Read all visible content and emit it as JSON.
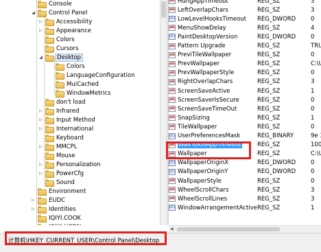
{
  "tree": {
    "items": [
      {
        "label": "Console",
        "expander": "",
        "level": 1
      },
      {
        "label": "Control Panel",
        "expander": "◢",
        "level": 1
      },
      {
        "label": "Accessibility",
        "expander": "▷",
        "level": 2
      },
      {
        "label": "Appearance",
        "expander": "▷",
        "level": 2
      },
      {
        "label": "Colors",
        "expander": "",
        "level": 2
      },
      {
        "label": "Cursors",
        "expander": "",
        "level": 2
      },
      {
        "label": "Desktop",
        "expander": "◢",
        "level": 2,
        "selected": true
      },
      {
        "label": "Colors",
        "expander": "",
        "level": 3
      },
      {
        "label": "LanguageConfiguration",
        "expander": "",
        "level": 3
      },
      {
        "label": "MuiCached",
        "expander": "",
        "level": 3
      },
      {
        "label": "WindowMetrics",
        "expander": "",
        "level": 3
      },
      {
        "label": "don't load",
        "expander": "",
        "level": 2
      },
      {
        "label": "Infrared",
        "expander": "▷",
        "level": 2
      },
      {
        "label": "Input Method",
        "expander": "▷",
        "level": 2
      },
      {
        "label": "International",
        "expander": "▷",
        "level": 2
      },
      {
        "label": "Keyboard",
        "expander": "",
        "level": 2
      },
      {
        "label": "MMCPL",
        "expander": "▷",
        "level": 2
      },
      {
        "label": "Mouse",
        "expander": "",
        "level": 2
      },
      {
        "label": "Personalization",
        "expander": "▷",
        "level": 2
      },
      {
        "label": "PowerCfg",
        "expander": "▷",
        "level": 2
      },
      {
        "label": "Sound",
        "expander": "",
        "level": 2
      },
      {
        "label": "Environment",
        "expander": "",
        "level": 1
      },
      {
        "label": "EUDC",
        "expander": "▷",
        "level": 1
      },
      {
        "label": "Identities",
        "expander": "▷",
        "level": 1
      },
      {
        "label": "IQIYI.COOK",
        "expander": "",
        "level": 1
      },
      {
        "label": "IQIYI.HCDN",
        "expander": "",
        "level": 1
      }
    ]
  },
  "values": {
    "rows": [
      {
        "icon": "ab",
        "name": "HungAppTimeout",
        "type": "REG_SZ",
        "data": "3"
      },
      {
        "icon": "ab",
        "name": "LeftOverlapChars",
        "type": "REG_SZ",
        "data": "3"
      },
      {
        "icon": "bin",
        "name": "LowLevelHooksTimeout",
        "type": "REG_DWORD",
        "data": "0"
      },
      {
        "icon": "ab",
        "name": "MenuShowDelay",
        "type": "REG_SZ",
        "data": "4"
      },
      {
        "icon": "bin",
        "name": "PaintDesktopVersion",
        "type": "REG_DWORD",
        "data": "0"
      },
      {
        "icon": "ab",
        "name": "Pattern Upgrade",
        "type": "REG_SZ",
        "data": "TRU"
      },
      {
        "icon": "ab",
        "name": "PreviTileWallpaper",
        "type": "REG_SZ",
        "data": "0"
      },
      {
        "icon": "ab",
        "name": "PrevWallpaper",
        "type": "REG_SZ",
        "data": "C:\\U"
      },
      {
        "icon": "ab",
        "name": "PrevWallpaperStyle",
        "type": "REG_SZ",
        "data": "0"
      },
      {
        "icon": "ab",
        "name": "RightOverlapChars",
        "type": "REG_SZ",
        "data": "3"
      },
      {
        "icon": "ab",
        "name": "ScreenSaveActive",
        "type": "REG_SZ",
        "data": "1"
      },
      {
        "icon": "ab",
        "name": "ScreenSaverIsSecure",
        "type": "REG_SZ",
        "data": "0"
      },
      {
        "icon": "ab",
        "name": "ScreenSaveTimeOut",
        "type": "REG_SZ",
        "data": "0"
      },
      {
        "icon": "ab",
        "name": "SnapSizing",
        "type": "REG_SZ",
        "data": "1"
      },
      {
        "icon": "ab",
        "name": "TileWallpaper",
        "type": "REG_SZ",
        "data": "0"
      },
      {
        "icon": "bin",
        "name": "UserPreferencesMask",
        "type": "REG_BINARY",
        "data": "9e 3"
      },
      {
        "icon": "ab",
        "name": "WaitToKillAppTimeout",
        "type": "REG_SZ",
        "data": "100",
        "selected": true
      },
      {
        "icon": "ab",
        "name": "Wallpaper",
        "type": "REG_SZ",
        "data": "C:\\U"
      },
      {
        "icon": "bin",
        "name": "WallpaperOriginX",
        "type": "REG_DWORD",
        "data": "0"
      },
      {
        "icon": "bin",
        "name": "WallpaperOriginY",
        "type": "REG_DWORD",
        "data": "0"
      },
      {
        "icon": "ab",
        "name": "WallpaperStyle",
        "type": "REG_SZ",
        "data": "0"
      },
      {
        "icon": "ab",
        "name": "WheelScrollChars",
        "type": "REG_SZ",
        "data": "3"
      },
      {
        "icon": "ab",
        "name": "WheelScrollLines",
        "type": "REG_SZ",
        "data": "3"
      },
      {
        "icon": "bin",
        "name": "WindowArrangementActive",
        "type": "REG_SZ",
        "data": "1"
      }
    ]
  },
  "status": {
    "path": "计算机\\HKEY_CURRENT_USER\\Control Panel\\Desktop"
  },
  "icons": {
    "folder": "folder-icon",
    "string_value": "string-value-icon",
    "binary_value": "binary-value-icon"
  },
  "colors": {
    "highlight_box": "#e02020",
    "selection": "#3399ff"
  }
}
